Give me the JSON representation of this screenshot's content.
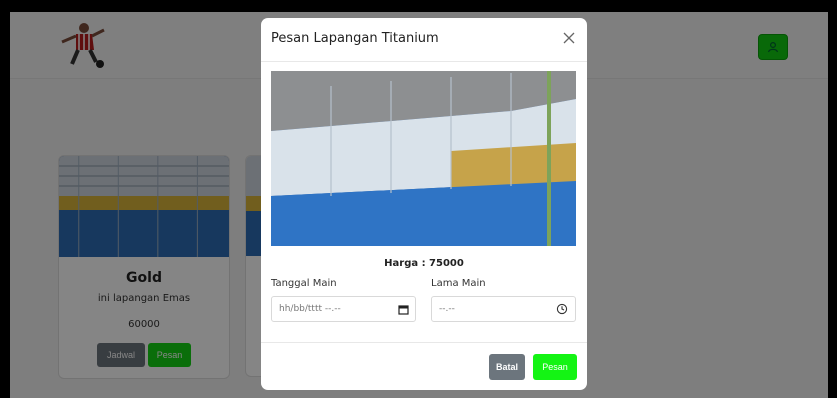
{
  "navbar": {
    "logo_icon": "soccer-player-icon",
    "user_icon": "user-icon",
    "accent": "#12c912"
  },
  "card": {
    "title": "Gold",
    "description": "ini lapangan Emas",
    "price": "60000",
    "jadwal_label": "Jadwal",
    "pesan_label": "Pesan"
  },
  "modal": {
    "title": "Pesan Lapangan Titanium",
    "close_icon": "close-icon",
    "price": "Harga : 75000",
    "date_label": "Tanggal Main",
    "date_value": "hh/bb/tttt --.--",
    "date_icon": "calendar-icon",
    "duration_label": "Lama Main",
    "duration_value": "--.--",
    "duration_icon": "clock-icon",
    "cancel_label": "Batal",
    "submit_label": "Pesan"
  },
  "colors": {
    "grey_button": "#6c757d",
    "green_button": "#14f414"
  }
}
